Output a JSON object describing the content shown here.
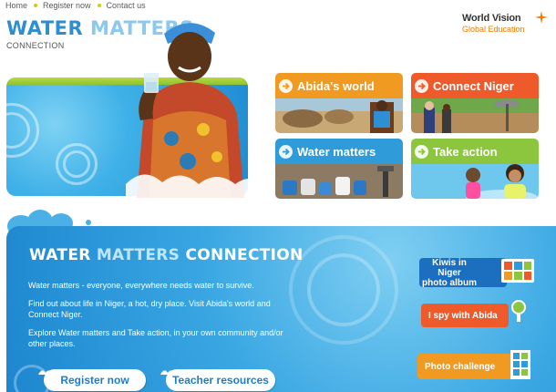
{
  "nav": {
    "home": "Home",
    "register": "Register now",
    "contact": "Contact us"
  },
  "logo": {
    "word1": "WATER",
    "word2": "MATTERS",
    "sub": "CONNECTION"
  },
  "partner": {
    "name": "World Vision",
    "sub": "Global Education"
  },
  "tiles": [
    {
      "label": "Abida's world",
      "color": "#f09a21"
    },
    {
      "label": "Connect Niger",
      "color": "#ef5a2b"
    },
    {
      "label": "Water matters",
      "color": "#2f9bd8"
    },
    {
      "label": "Take action",
      "color": "#8cc63f"
    }
  ],
  "panel": {
    "title_a": "WATER",
    "title_b": "MATTERS",
    "title_c": "CONNECTION",
    "p1": "Water matters - everyone, everywhere needs water to survive.",
    "p2": "Find out about life in Niger, a hot, dry place. Visit Abida's world and Connect Niger.",
    "p3": "Explore Water matters and Take action, in your own community and/or other places.",
    "register": "Register now",
    "teacher": "Teacher resources"
  },
  "side_links": {
    "kiwis_1": "Kiwis in Niger",
    "kiwis_2": "photo album",
    "spy": "I spy with Abida",
    "photo": "Photo challenge"
  }
}
